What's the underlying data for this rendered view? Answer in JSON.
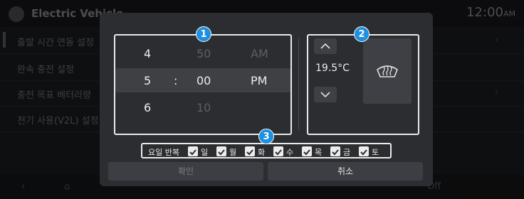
{
  "background": {
    "app_title": "Electric Vehicle",
    "clock_time": "12:00",
    "clock_ampm": "AM",
    "menu_items": [
      "출발 시간 연동 설정",
      "완속 충전 설정",
      "충전 목표 배터리량",
      "전기 사용(V2L) 설정"
    ],
    "nav_off_label": "Off"
  },
  "dialog": {
    "markers": [
      "1",
      "2",
      "3"
    ],
    "time_picker": {
      "hours": [
        "4",
        "5",
        "6"
      ],
      "separator": ":",
      "minutes": [
        "50",
        "00",
        "10"
      ],
      "ampm": [
        "AM",
        "PM"
      ]
    },
    "climate": {
      "temperature": "19.5°C"
    },
    "days": {
      "label": "요일 반복",
      "items": [
        "일",
        "월",
        "화",
        "수",
        "목",
        "금",
        "토"
      ]
    },
    "buttons": {
      "confirm": "확인",
      "cancel": "취소"
    }
  },
  "colors": {
    "marker": "#1f8fe0",
    "dialog_bg": "#2c2d31",
    "selected_row": "#3e4045"
  }
}
